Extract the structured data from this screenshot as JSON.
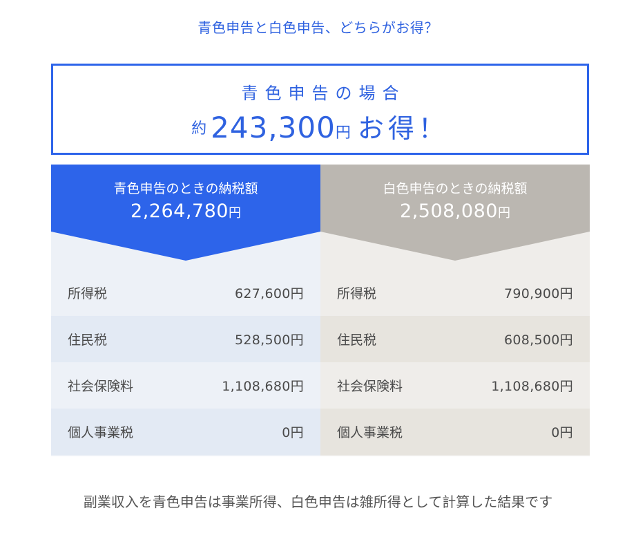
{
  "heading": "青色申告と白色申告、どちらがお得？",
  "result": {
    "label": "青色申告の場合",
    "prefix": "約",
    "amount": "243,300",
    "yen": "円",
    "suffix": "お得！"
  },
  "blue": {
    "title": "青色申告のときの納税額",
    "total": "2,264,780",
    "yen": "円",
    "rows": [
      {
        "label": "所得税",
        "value": "627,600円"
      },
      {
        "label": "住民税",
        "value": "528,500円"
      },
      {
        "label": "社会保険料",
        "value": "1,108,680円"
      },
      {
        "label": "個人事業税",
        "value": "0円"
      }
    ]
  },
  "white": {
    "title": "白色申告のときの納税額",
    "total": "2,508,080",
    "yen": "円",
    "rows": [
      {
        "label": "所得税",
        "value": "790,900円"
      },
      {
        "label": "住民税",
        "value": "608,500円"
      },
      {
        "label": "社会保険料",
        "value": "1,108,680円"
      },
      {
        "label": "個人事業税",
        "value": "0円"
      }
    ]
  },
  "note": "副業収入を青色申告は事業所得、白色申告は雑所得として計算した結果です",
  "colors": {
    "accent_blue": "#2d64ea",
    "header_gray": "#bbb7b1",
    "text_blue": "#2f62e0"
  }
}
